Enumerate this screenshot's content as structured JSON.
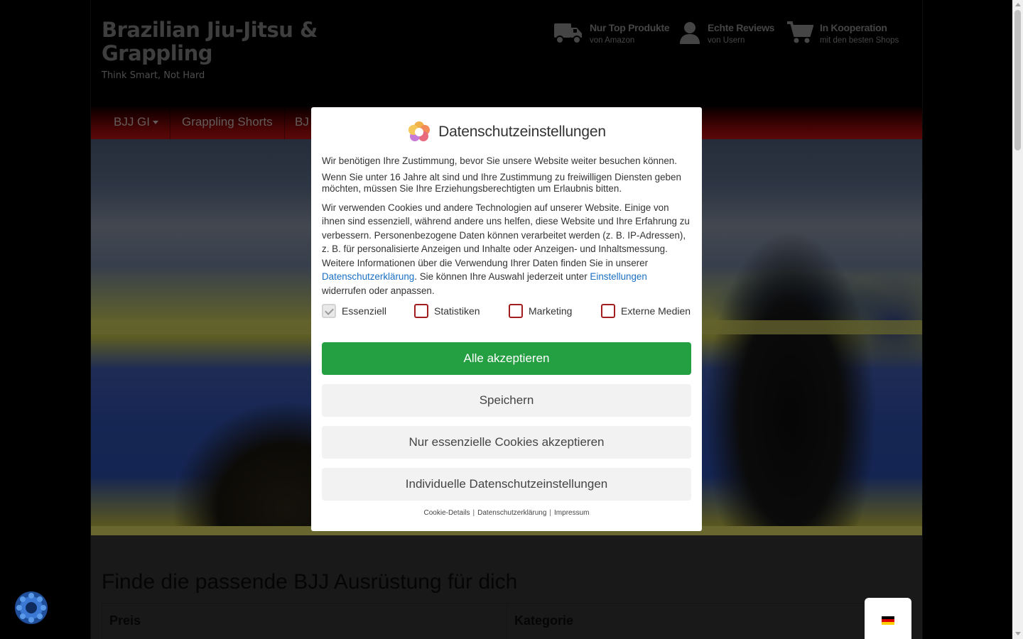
{
  "site": {
    "title": "Brazilian Jiu-Jitsu & Grappling",
    "tagline": "Think Smart, Not Hard"
  },
  "usps": [
    {
      "icon": "truck-icon",
      "title": "Nur Top Produkte",
      "sub": "von Amazon"
    },
    {
      "icon": "user-icon",
      "title": "Echte Reviews",
      "sub": "von Usern"
    },
    {
      "icon": "cart-icon",
      "title": "In Kooperation",
      "sub": "mit den besten Shops"
    }
  ],
  "nav": {
    "items": [
      {
        "label": "BJJ GI"
      },
      {
        "label": "Grappling Shorts"
      },
      {
        "label": "BJ"
      }
    ]
  },
  "content": {
    "heading": "Finde die passende BJJ Ausrüstung für dich",
    "filter_left": "Preis",
    "filter_right": "Kategorie"
  },
  "modal": {
    "title": "Datenschutzeinstellungen",
    "p1": "Wir benötigen Ihre Zustimmung, bevor Sie unsere Website weiter besuchen können.",
    "p2": "Wenn Sie unter 16 Jahre alt sind und Ihre Zustimmung zu freiwilligen Diensten geben möchten, müssen Sie Ihre Erziehungsberechtigten um Erlaubnis bitten.",
    "p3_a": "Wir verwenden Cookies und andere Technologien auf unserer Website. Einige von ihnen sind essenziell, während andere uns helfen, diese Website und Ihre Erfahrung zu verbessern. Personenbezogene Daten können verarbeitet werden (z. B. IP-Adressen), z. B. für personalisierte Anzeigen und Inhalte oder Anzeigen- und Inhaltsmessung. Weitere Informationen über die Verwendung Ihrer Daten finden Sie in unserer ",
    "p3_link1": "Datenschutzerklärung",
    "p3_b": ". Sie können Ihre Auswahl jederzeit unter ",
    "p3_link2": "Einstellungen",
    "p3_c": " widerrufen oder anpassen.",
    "checkboxes": [
      {
        "label": "Essenziell",
        "checked": true,
        "disabled": true
      },
      {
        "label": "Statistiken",
        "checked": false
      },
      {
        "label": "Marketing",
        "checked": false
      },
      {
        "label": "Externe Medien",
        "checked": false
      }
    ],
    "btn_accept_all": "Alle akzeptieren",
    "btn_save": "Speichern",
    "btn_essential": "Nur essenzielle Cookies akzeptieren",
    "btn_individual": "Individuelle Datenschutzeinstellungen",
    "footer_links": [
      "Cookie-Details",
      "Datenschutzerklärung",
      "Impressum"
    ],
    "footer_sep": "|"
  },
  "colors": {
    "accept": "#24a042",
    "link": "#1a6fc4",
    "nav_red": "#b31212",
    "checkbox_border": "#a21e1e"
  }
}
